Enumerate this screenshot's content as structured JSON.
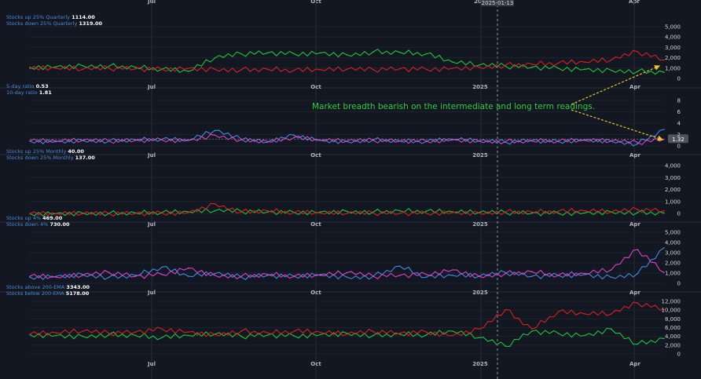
{
  "colors": {
    "background": "#131722",
    "grid": "#2a2e39",
    "text": "#b2b5be",
    "label_blue": "#4a8bd6",
    "value_white": "#ffffff",
    "green": "#22c33a",
    "red": "#d92020",
    "blue": "#3d8be0",
    "magenta": "#e040c8",
    "annotation": "#2ecc40",
    "arrow": "#e8c030"
  },
  "crosshair": {
    "label": "2025-01-13"
  },
  "top_cut_labels": [
    "Jul",
    "Oct",
    "20",
    "Apr"
  ],
  "annotation": {
    "text": "Market breadth bearish on the intermediate and long term readings."
  },
  "chart_data": [
    {
      "type": "line",
      "legend": [
        {
          "name": "Stocks up 25% Quarterly",
          "value": "1114.00"
        },
        {
          "name": "Stocks down 25% Quarterly",
          "value": "1319.00"
        }
      ],
      "yticks": [
        "5,000",
        "4,000",
        "3,000",
        "2,000",
        "1,000",
        "0"
      ],
      "ylim": [
        -300,
        5500
      ],
      "xticks": [
        "Jul",
        "Oct",
        "2025",
        "Apr"
      ],
      "series": [
        {
          "name": "Stocks up 25% Quarterly",
          "color": "green",
          "values": [
            1100,
            1150,
            1250,
            1200,
            1100,
            900,
            700,
            2000,
            2400,
            2500,
            2400,
            2500,
            2300,
            2600,
            2550,
            2400,
            1600,
            1300,
            1200,
            1100,
            1000,
            900,
            800,
            700,
            600
          ]
        },
        {
          "name": "Stocks down 25% Quarterly",
          "color": "red",
          "values": [
            950,
            1000,
            900,
            1000,
            950,
            900,
            1000,
            900,
            850,
            900,
            800,
            850,
            900,
            850,
            950,
            900,
            1000,
            1100,
            1300,
            1400,
            1500,
            1600,
            1800,
            2600,
            1800
          ]
        }
      ]
    },
    {
      "type": "line",
      "legend": [
        {
          "name": "5-day ratio",
          "value": "0.53"
        },
        {
          "name": "10-day ratio",
          "value": "1.81"
        }
      ],
      "yticks": [
        "8",
        "6",
        "4",
        "2",
        "0"
      ],
      "ylim": [
        -0.4,
        8.8
      ],
      "xticks": [
        "Jul",
        "Oct",
        "2025",
        "Apr"
      ],
      "last_value_badge": "1.32",
      "series": [
        {
          "name": "5-day ratio",
          "color": "blue",
          "values": [
            1.0,
            0.9,
            1.1,
            1.0,
            1.2,
            1.3,
            1.1,
            2.8,
            1.3,
            0.8,
            2.0,
            1.1,
            0.9,
            1.2,
            1.0,
            0.9,
            1.3,
            1.0,
            0.8,
            1.1,
            0.9,
            1.2,
            1.0,
            0.5,
            3.0
          ]
        },
        {
          "name": "10-day ratio",
          "color": "magenta",
          "values": [
            1.0,
            1.0,
            1.1,
            1.0,
            1.1,
            1.2,
            1.1,
            2.0,
            1.2,
            0.9,
            1.6,
            1.1,
            1.0,
            1.1,
            1.0,
            1.0,
            1.2,
            1.0,
            0.9,
            1.0,
            1.0,
            1.1,
            1.0,
            0.7,
            1.3
          ]
        }
      ]
    },
    {
      "type": "line",
      "legend": [
        {
          "name": "Stocks up 25% Monthly",
          "value": "40.00"
        },
        {
          "name": "Stocks down 25% Monthly",
          "value": "137.00"
        }
      ],
      "yticks": [
        "4,000",
        "3,000",
        "2,000",
        "1,000",
        "0"
      ],
      "ylim": [
        -200,
        4600
      ],
      "xticks": [
        "Jul",
        "Oct",
        "2025",
        "Apr"
      ],
      "series": [
        {
          "name": "Stocks up 25% Monthly",
          "color": "green",
          "values": [
            50,
            60,
            100,
            80,
            120,
            150,
            200,
            300,
            250,
            200,
            150,
            200,
            250,
            200,
            300,
            250,
            200,
            150,
            150,
            100,
            100,
            120,
            200,
            150,
            100
          ]
        },
        {
          "name": "Stocks down 25% Monthly",
          "color": "red",
          "values": [
            40,
            50,
            60,
            50,
            80,
            100,
            150,
            900,
            200,
            300,
            150,
            100,
            80,
            100,
            80,
            100,
            150,
            120,
            200,
            200,
            250,
            300,
            200,
            400,
            300
          ]
        }
      ]
    },
    {
      "type": "line",
      "legend": [
        {
          "name": "Stocks up 4%",
          "value": "469.00"
        },
        {
          "name": "Stocks down 4%",
          "value": "730.00"
        }
      ],
      "yticks": [
        "5,000",
        "4,000",
        "3,000",
        "2,000",
        "1,000",
        "0"
      ],
      "ylim": [
        -600,
        5800
      ],
      "xticks": [
        "Jul",
        "Oct",
        "2025",
        "Apr"
      ],
      "series": [
        {
          "name": "Stocks up 4%",
          "color": "blue",
          "values": [
            400,
            500,
            700,
            400,
            600,
            1500,
            500,
            800,
            400,
            600,
            500,
            700,
            400,
            500,
            1600,
            400,
            600,
            500,
            900,
            500,
            600,
            700,
            400,
            800,
            3600
          ]
        },
        {
          "name": "Stocks down 4%",
          "color": "magenta",
          "values": [
            500,
            400,
            600,
            900,
            500,
            700,
            1400,
            600,
            500,
            700,
            500,
            600,
            900,
            500,
            600,
            700,
            1200,
            500,
            800,
            1000,
            600,
            800,
            1200,
            3400,
            900
          ]
        }
      ]
    },
    {
      "type": "line",
      "legend": [
        {
          "name": "Stocks above 200-EMA",
          "value": "3343.00"
        },
        {
          "name": "Stocks below 200-EMA",
          "value": "5178.00"
        }
      ],
      "yticks": [
        "12,000",
        "10,000",
        "8,000",
        "6,000",
        "4,000",
        "2,000",
        "0"
      ],
      "ylim": [
        -1000,
        13000
      ],
      "xticks": [
        "Jul",
        "Oct",
        "2025",
        "Apr"
      ],
      "series": [
        {
          "name": "Stocks above 200-EMA",
          "color": "green",
          "values": [
            4200,
            4000,
            3800,
            4200,
            4000,
            3500,
            4000,
            4300,
            3800,
            4100,
            3900,
            4200,
            4500,
            4000,
            4300,
            4100,
            5000,
            3500,
            1500,
            5000,
            4500,
            4000,
            5500,
            2000,
            3300
          ]
        },
        {
          "name": "Stocks below 200-EMA",
          "color": "red",
          "values": [
            4300,
            4600,
            5000,
            4500,
            4800,
            5500,
            4800,
            4200,
            5000,
            4600,
            5000,
            4700,
            4300,
            4900,
            4500,
            4800,
            4000,
            5500,
            10000,
            5500,
            9500,
            9000,
            9000,
            11500,
            10000
          ]
        }
      ]
    }
  ]
}
